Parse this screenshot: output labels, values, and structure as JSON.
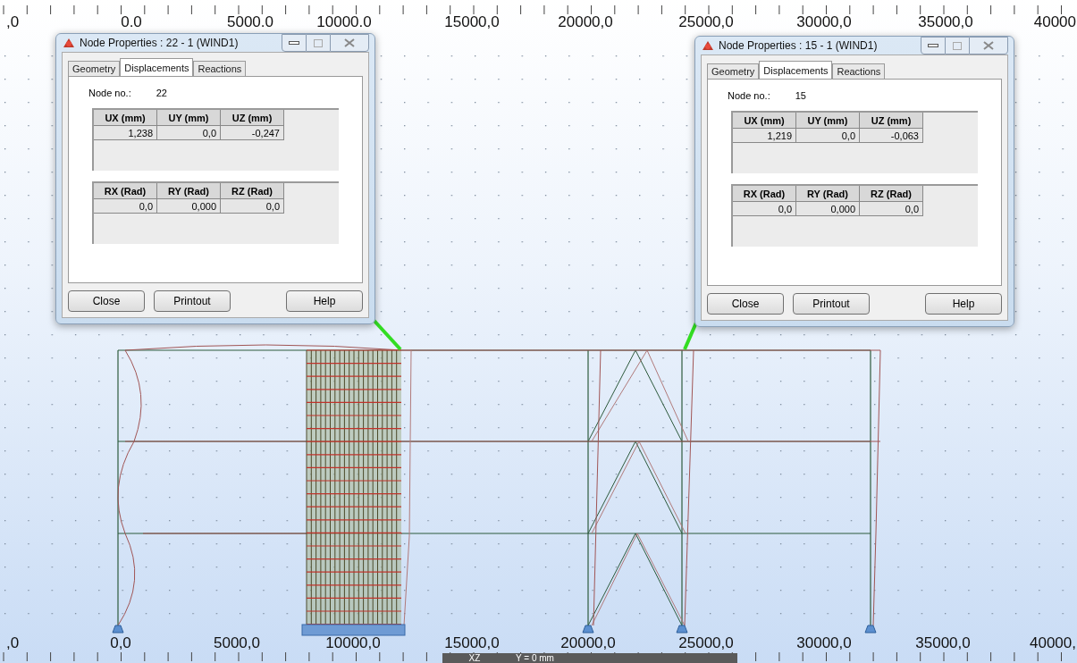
{
  "ruler_top": {
    "labels": [
      ",0",
      "0.0",
      "5000.0",
      "10000.0",
      "15000,0",
      "20000,0",
      "25000,0",
      "30000,0",
      "35000,0",
      "40000"
    ]
  },
  "ruler_bottom": {
    "labels": [
      ",0",
      "0,0",
      "5000,0",
      "10000,0",
      "15000,0",
      "20000,0",
      "25000,0",
      "30000,0",
      "35000,0",
      "40000,"
    ]
  },
  "view_bar": {
    "plane": "XZ",
    "position": "Y = 0 mm"
  },
  "dialogs": [
    {
      "title": "Node Properties : 22 - 1 (WIND1)",
      "tabs": [
        {
          "label": "Geometry",
          "selected": false
        },
        {
          "label": "Displacements",
          "selected": true
        },
        {
          "label": "Reactions",
          "selected": false
        }
      ],
      "node_label": "Node no.:",
      "node_no": "22",
      "displacements": {
        "columns": [
          "UX (mm)",
          "UY (mm)",
          "UZ (mm)"
        ],
        "values": [
          "1,238",
          "0,0",
          "-0,247"
        ]
      },
      "rotations": {
        "columns": [
          "RX (Rad)",
          "RY (Rad)",
          "RZ (Rad)"
        ],
        "values": [
          "0,0",
          "0,000",
          "0,0"
        ]
      },
      "buttons": [
        "Close",
        "Printout",
        "Help"
      ]
    },
    {
      "title": "Node Properties : 15 - 1 (WIND1)",
      "tabs": [
        {
          "label": "Geometry",
          "selected": false
        },
        {
          "label": "Displacements",
          "selected": true
        },
        {
          "label": "Reactions",
          "selected": false
        }
      ],
      "node_label": "Node no.:",
      "node_no": "15",
      "displacements": {
        "columns": [
          "UX (mm)",
          "UY (mm)",
          "UZ (mm)"
        ],
        "values": [
          "1,219",
          "0,0",
          "-0,063"
        ]
      },
      "rotations": {
        "columns": [
          "RX (Rad)",
          "RY (Rad)",
          "RZ (Rad)"
        ],
        "values": [
          "0,0",
          "0,000",
          "0,0"
        ]
      },
      "buttons": [
        "Close",
        "Printout",
        "Help"
      ]
    }
  ]
}
